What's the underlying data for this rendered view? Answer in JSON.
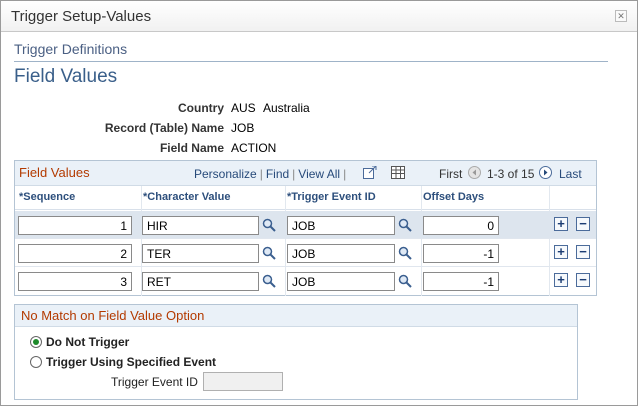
{
  "window": {
    "title": "Trigger Setup-Values",
    "close_glyph": "✕"
  },
  "section_title": "Trigger Definitions",
  "page_title": "Field Values",
  "info": {
    "country_label": "Country",
    "country_code": "AUS",
    "country_name": "Australia",
    "record_label": "Record (Table) Name",
    "record_value": "JOB",
    "field_label": "Field Name",
    "field_value": "ACTION"
  },
  "grid": {
    "title": "Field Values",
    "personalize": "Personalize",
    "find": "Find",
    "view_all": "View All",
    "first": "First",
    "range": "1-3 of 15",
    "last": "Last",
    "columns": {
      "sequence": "*Sequence",
      "char_value": "*Character Value",
      "trigger_event": "*Trigger Event ID",
      "offset_days": "Offset Days"
    },
    "rows": [
      {
        "sequence": "1",
        "char_value": "HIR",
        "trigger_event": "JOB",
        "offset_days": "0"
      },
      {
        "sequence": "2",
        "char_value": "TER",
        "trigger_event": "JOB",
        "offset_days": "-1"
      },
      {
        "sequence": "3",
        "char_value": "RET",
        "trigger_event": "JOB",
        "offset_days": "-1"
      }
    ],
    "add_glyph": "+",
    "delete_glyph": "−"
  },
  "no_match": {
    "title": "No Match on Field Value Option",
    "option1": "Do Not Trigger",
    "option2": "Trigger Using Specified Event",
    "event_label": "Trigger Event ID",
    "selected": "option1"
  },
  "colors": {
    "accent": "#3a5f8a",
    "grid_title": "#b33a00",
    "link": "#274a7a",
    "highlight_row": "#dde5ee"
  }
}
